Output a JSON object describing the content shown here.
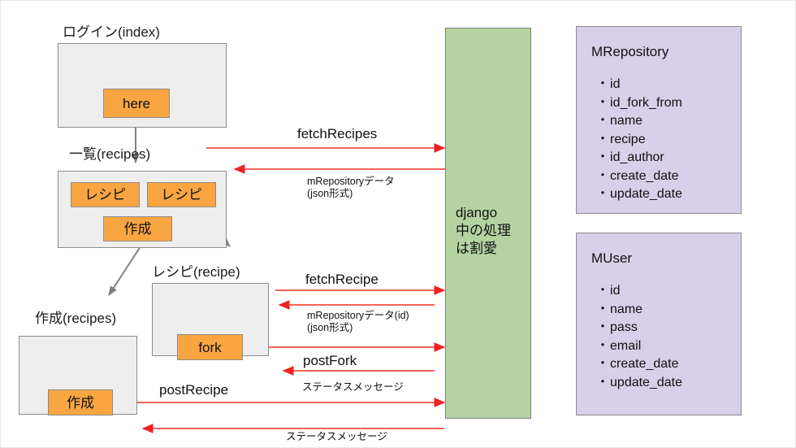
{
  "diagram": {
    "title": "django recipe app sequence diagram",
    "colors": {
      "screen_fill": "#eeeeee",
      "screen_border": "#8c8c8c",
      "button_fill": "#f9a541",
      "entity_fill": "#d7d0e8",
      "server_fill": "#b4d3a1",
      "arrow_red": "#f4645a",
      "arrow_gray": "#808080"
    }
  },
  "screens": [
    {
      "id": "login",
      "label": "ログイン(index)",
      "buttons": [
        {
          "id": "here",
          "label": "here"
        }
      ]
    },
    {
      "id": "recipes_list",
      "label": "一覧(recipes)",
      "buttons": [
        {
          "id": "recipe_1",
          "label": "レシピ"
        },
        {
          "id": "recipe_2",
          "label": "レシピ"
        },
        {
          "id": "create_1",
          "label": "作成"
        }
      ]
    },
    {
      "id": "recipe_detail",
      "label": "レシピ(recipe)",
      "buttons": [
        {
          "id": "fork",
          "label": "fork"
        }
      ]
    },
    {
      "id": "recipe_create",
      "label": "作成(recipes)",
      "buttons": [
        {
          "id": "create_2",
          "label": "作成"
        }
      ]
    }
  ],
  "server": {
    "id": "django",
    "text": "django\n中の処理\nは割愛"
  },
  "entities": [
    {
      "id": "m_repository",
      "title": "MRepository",
      "fields": [
        "id",
        "id_fork_from",
        "name",
        "recipe",
        "id_author",
        "create_date",
        "update_date"
      ]
    },
    {
      "id": "m_user",
      "title": "MUser",
      "fields": [
        "id",
        "name",
        "pass",
        "email",
        "create_date",
        "update_date"
      ]
    }
  ],
  "messages": [
    {
      "id": "fetch_recipes_request",
      "label": "fetchRecipes",
      "direction": "to-server",
      "sub": ""
    },
    {
      "id": "fetch_recipes_response",
      "label": "",
      "direction": "from-server",
      "sub": "mRepositoryデータ\n(json形式)"
    },
    {
      "id": "fetch_recipe_request",
      "label": "fetchRecipe",
      "direction": "to-server",
      "sub": ""
    },
    {
      "id": "fetch_recipe_response",
      "label": "",
      "direction": "from-server",
      "sub": "mRepositoryデータ(id)\n(json形式)"
    },
    {
      "id": "post_fork_request",
      "label": "postFork",
      "direction": "to-server",
      "sub": ""
    },
    {
      "id": "post_fork_response",
      "label": "",
      "direction": "from-server",
      "sub": "ステータスメッセージ"
    },
    {
      "id": "post_recipe_request",
      "label": "postRecipe",
      "direction": "to-server",
      "sub": ""
    },
    {
      "id": "post_recipe_response",
      "label": "",
      "direction": "from-server",
      "sub": "ステータスメッセージ"
    }
  ]
}
